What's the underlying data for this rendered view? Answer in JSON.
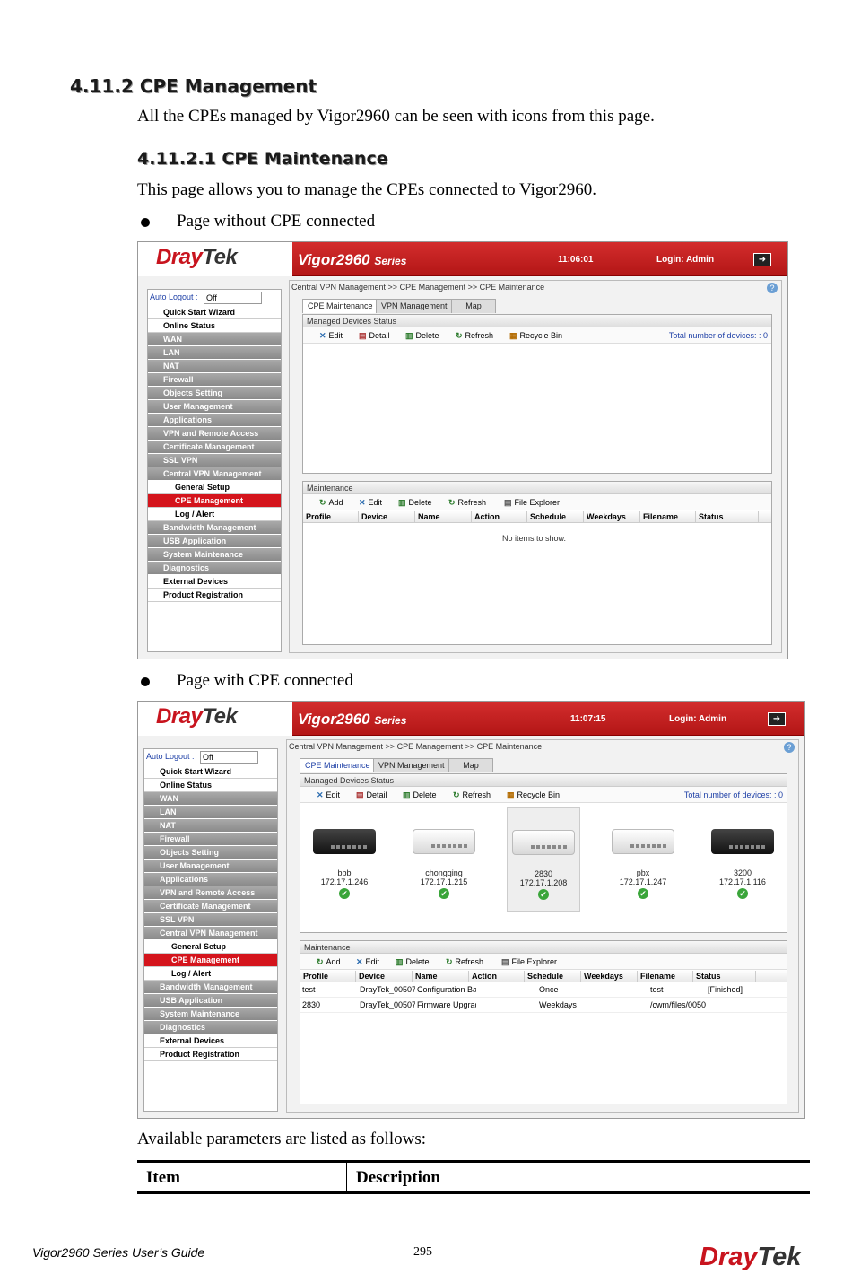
{
  "heading": "4.11.2 CPE Management",
  "intro": "All the CPEs managed by Vigor2960 can be seen with icons from this page.",
  "subheading": "4.11.2.1 CPE Maintenance",
  "sub_intro": "This page allows you to manage the CPEs connected to Vigor2960.",
  "bullet1": "Page without CPE connected",
  "bullet2": "Page with CPE connected",
  "available": "Available parameters are listed as follows:",
  "table": {
    "col1": "Item",
    "col2": "Description"
  },
  "footer": {
    "guide": "Vigor2960 Series User’s Guide",
    "page": "295",
    "logo_a": "Dray",
    "logo_b": "Tek"
  },
  "ui": {
    "logo_a": "Dray",
    "logo_b": "Tek",
    "model": "Vigor2960",
    "series": "Series",
    "login": "Login: Admin",
    "auto_logout_label": "Auto Logout :",
    "auto_logout_value": "Off",
    "breadcrumb": "Central VPN Management >> CPE Management >> CPE Maintenance",
    "tabs": [
      "CPE Maintenance",
      "VPN Management",
      "Map"
    ],
    "managed_title": "Managed Devices Status",
    "managed_toolbar": [
      "Edit",
      "Detail",
      "Delete",
      "Refresh",
      "Recycle Bin"
    ],
    "total_label": "Total number of devices:",
    "maintenance_title": "Maintenance",
    "maintenance_toolbar": [
      "Add",
      "Edit",
      "Delete",
      "Refresh",
      "File Explorer"
    ],
    "columns": [
      "Profile",
      "Device",
      "Name",
      "Action",
      "Schedule",
      "Weekdays",
      "Filename",
      "Status"
    ],
    "no_items": "No items to show.",
    "menu": [
      {
        "label": "Quick Start Wizard",
        "style": "w"
      },
      {
        "label": "Online Status",
        "style": "w"
      },
      {
        "label": "WAN",
        "style": "g"
      },
      {
        "label": "LAN",
        "style": "g"
      },
      {
        "label": "NAT",
        "style": "g"
      },
      {
        "label": "Firewall",
        "style": "g"
      },
      {
        "label": "Objects Setting",
        "style": "g"
      },
      {
        "label": "User Management",
        "style": "g"
      },
      {
        "label": "Applications",
        "style": "g"
      },
      {
        "label": "VPN and Remote Access",
        "style": "g"
      },
      {
        "label": "Certificate Management",
        "style": "g"
      },
      {
        "label": "SSL VPN",
        "style": "g"
      },
      {
        "label": "Central VPN Management",
        "style": "g"
      },
      {
        "label": "General Setup",
        "style": "sub"
      },
      {
        "label": "CPE Management",
        "style": "sel"
      },
      {
        "label": "Log / Alert",
        "style": "sub"
      },
      {
        "label": "Bandwidth Management",
        "style": "g"
      },
      {
        "label": "USB Application",
        "style": "g"
      },
      {
        "label": "System Maintenance",
        "style": "g"
      },
      {
        "label": "Diagnostics",
        "style": "g"
      },
      {
        "label": "External Devices",
        "style": "w"
      },
      {
        "label": "Product Registration",
        "style": "w"
      }
    ]
  },
  "shot1": {
    "time": "11:06:01",
    "total": "0"
  },
  "shot2": {
    "time": "11:07:15",
    "total": "0",
    "devices": [
      {
        "name": "bbb",
        "ip": "172.17.1.246",
        "color": "black"
      },
      {
        "name": "chongqing",
        "ip": "172.17.1.215",
        "color": "white"
      },
      {
        "name": "2830",
        "ip": "172.17.1.208",
        "color": "white"
      },
      {
        "name": "pbx",
        "ip": "172.17.1.247",
        "color": "white"
      },
      {
        "name": "3200",
        "ip": "172.17.1.116",
        "color": "black"
      }
    ],
    "rows": [
      {
        "profile": "test",
        "device": "DrayTek_00507F_",
        "name": "Configuration Bac",
        "action": "",
        "schedule": "Once",
        "weekdays": "",
        "filename": "test",
        "status": "[Finished]"
      },
      {
        "profile": "2830",
        "device": "DrayTek_00507F_",
        "name": "Firmware Upgrad",
        "action": "",
        "schedule": "Weekdays",
        "weekdays": "",
        "filename": "/cwm/files/0050",
        "status": ""
      }
    ]
  }
}
